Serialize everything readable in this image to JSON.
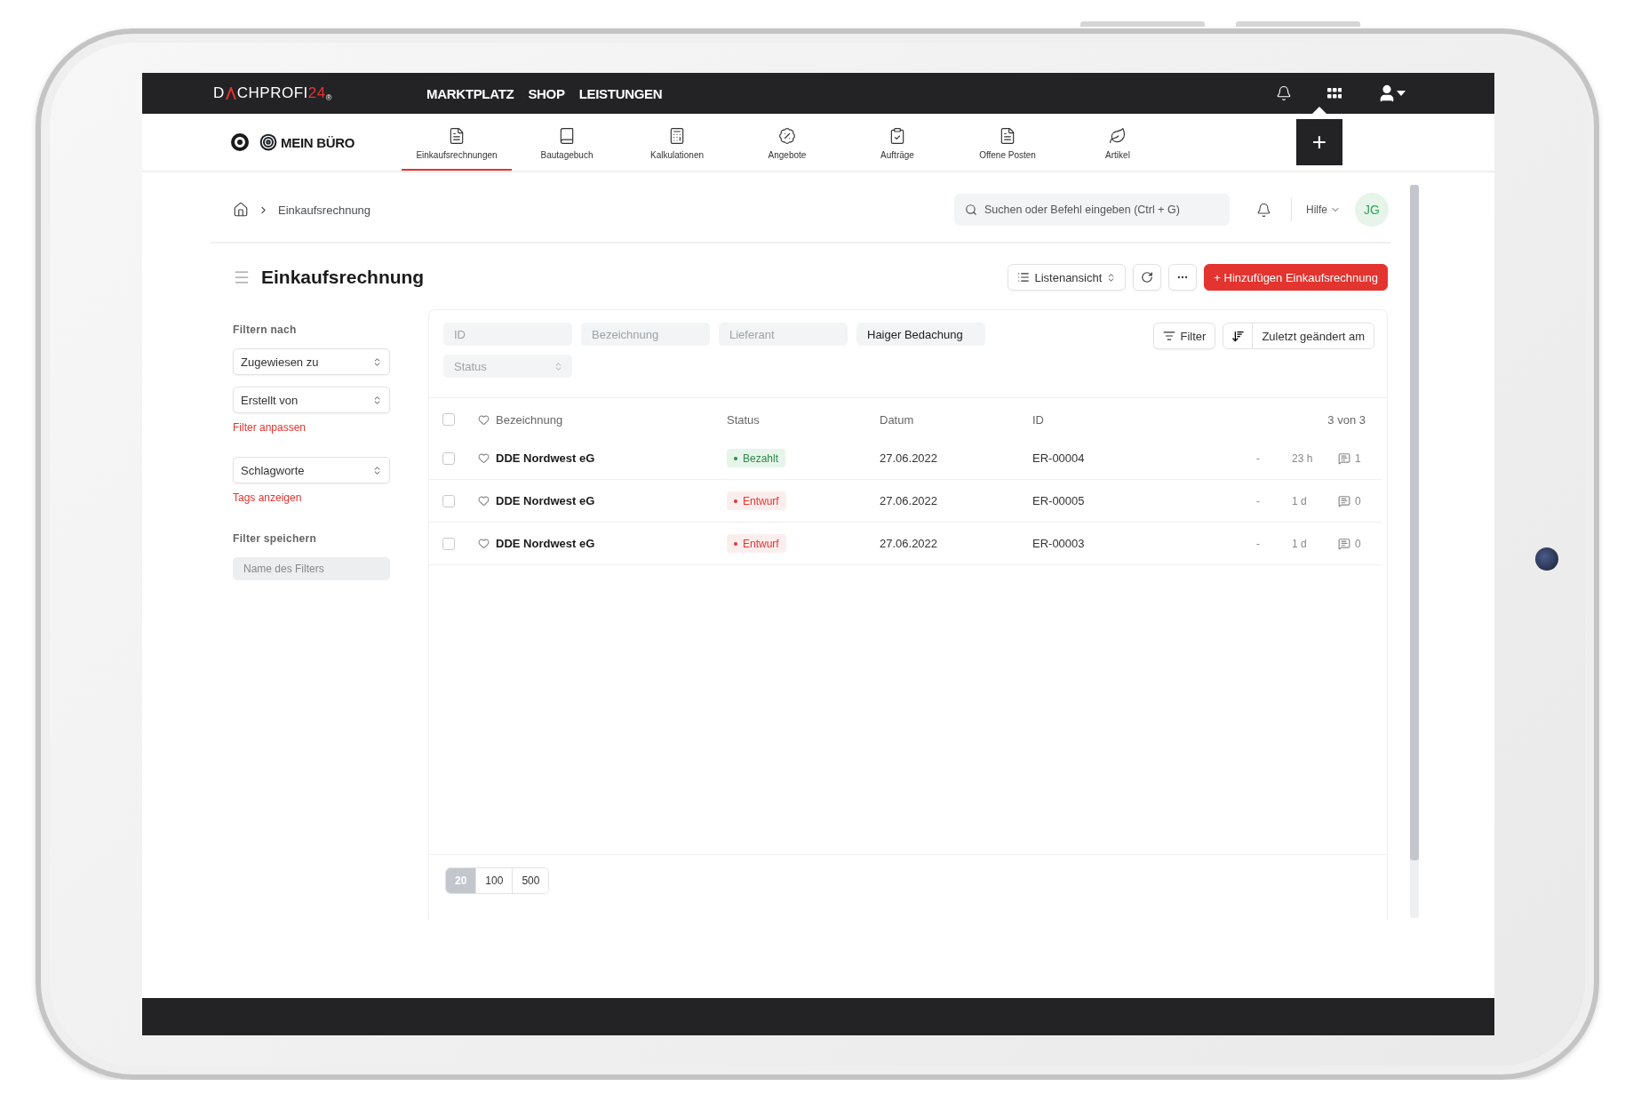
{
  "topbar": {
    "logo": {
      "first": "D",
      "rest": "CHPROFI",
      "number": "24",
      "mark": "®"
    },
    "nav": [
      "MARKTPLATZ",
      "SHOP",
      "LEISTUNGEN"
    ]
  },
  "subnav": {
    "brand": "MEIN BÜRO",
    "tabs": [
      {
        "label": "Einkaufsrechnungen",
        "kind": "invoice",
        "selected": true
      },
      {
        "label": "Bautagebuch",
        "kind": "book",
        "selected": false
      },
      {
        "label": "Kalkulationen",
        "kind": "calculator",
        "selected": false
      },
      {
        "label": "Angebote",
        "kind": "percent",
        "selected": false
      },
      {
        "label": "Aufträge",
        "kind": "clipboard",
        "selected": false
      },
      {
        "label": "Offene Posten",
        "kind": "invoice",
        "selected": false
      },
      {
        "label": "Artikel",
        "kind": "leaf",
        "selected": false
      }
    ],
    "add_button": "+"
  },
  "header": {
    "breadcrumb": [
      "Einkaufsrechnung"
    ],
    "search": {
      "placeholder": "Suchen oder Befehl eingeben (Ctrl + G)"
    },
    "help": "Hilfe",
    "avatar": "JG"
  },
  "page": {
    "title": "Einkaufsrechnung",
    "view_button": "Listenansicht",
    "add_button": "+ Hinzufügen Einkaufsrechnung"
  },
  "sidebar": {
    "heading": "Filtern nach",
    "selects": [
      "Zugewiesen zu",
      "Erstellt von"
    ],
    "link": "Filter anpassen",
    "tag_select": "Schlagworte",
    "tag_link": "Tags anzeigen",
    "save_heading": "Filter speichern",
    "save_field": {
      "placeholder": "Name des Filters"
    }
  },
  "filters": {
    "fields": [
      {
        "placeholder": "ID"
      },
      {
        "placeholder": "Bezeichnung"
      },
      {
        "placeholder": "Lieferant"
      },
      {
        "value": "Haiger Bedachung"
      }
    ],
    "status": {
      "placeholder": "Status"
    },
    "filter_button": "Filter",
    "sort_button": "Zuletzt geändert am"
  },
  "table": {
    "all_checked": false,
    "columns": [
      "Bezeichnung",
      "Status",
      "Datum",
      "ID"
    ],
    "count": "3 von 3",
    "rows": [
      {
        "checked": false,
        "favorite": false,
        "name": "DDE Nordwest eG",
        "status": {
          "label": "Bezahlt",
          "kind": "paid"
        },
        "date": "27.06.2022",
        "id": "ER-00004",
        "assignee": "-",
        "age": "23 h",
        "comments": "1"
      },
      {
        "checked": false,
        "favorite": false,
        "name": "DDE Nordwest eG",
        "status": {
          "label": "Entwurf",
          "kind": "draft"
        },
        "date": "27.06.2022",
        "id": "ER-00005",
        "assignee": "-",
        "age": "1 d",
        "comments": "0"
      },
      {
        "checked": false,
        "favorite": false,
        "name": "DDE Nordwest eG",
        "status": {
          "label": "Entwurf",
          "kind": "draft"
        },
        "date": "27.06.2022",
        "id": "ER-00003",
        "assignee": "-",
        "age": "1 d",
        "comments": "0"
      }
    ]
  },
  "pagination": [
    {
      "label": "20",
      "selected": true
    },
    {
      "label": "100",
      "selected": false
    },
    {
      "label": "500",
      "selected": false
    }
  ]
}
